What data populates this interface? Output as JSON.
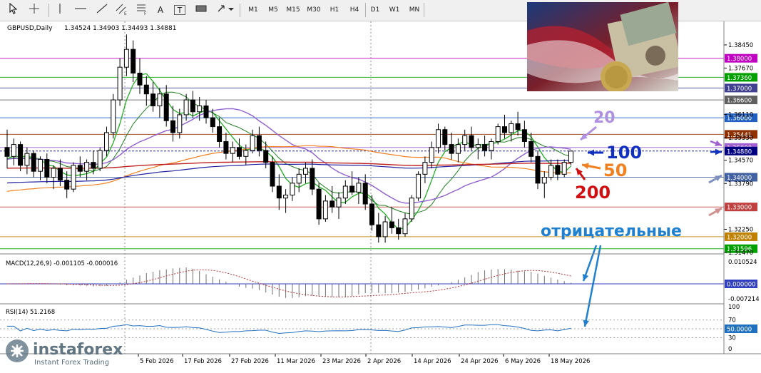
{
  "toolbar": {
    "timeframes": [
      "M1",
      "M5",
      "M15",
      "M30",
      "H1",
      "H4",
      "D1",
      "W1",
      "MN"
    ],
    "tools": {
      "crosshair": "crosshair-icon",
      "vline": "vertical-line-icon",
      "hline": "horizontal-line-icon",
      "trendline": "trendline-icon",
      "equidistant": "equidistant-channel-icon",
      "fibo": "fibonacci-icon",
      "text": "A",
      "label": "T",
      "rect": "rectangle-icon",
      "arrows": "arrows-icon"
    }
  },
  "header": {
    "symbol": "GBPUSD,Daily",
    "ohlc": "1.34524 1.34903 1.34493 1.34881"
  },
  "macd": {
    "label": "MACD(12,26,9) -0.001105 -0.000016",
    "axis": [
      "0.010524",
      "0.000000",
      "-0.007214"
    ]
  },
  "rsi": {
    "label": "RSI(14) 51.2168",
    "axis": [
      "100",
      "70",
      "50.0000",
      "30",
      "0"
    ]
  },
  "price_axis": {
    "ticks": [
      "1.38450",
      "1.37670",
      "1.36110",
      "1.35330",
      "1.34570",
      "1.33790",
      "1.32250",
      "1.31470"
    ],
    "levels": [
      {
        "label": "1.38000",
        "color": "#c000c0"
      },
      {
        "label": "1.37360",
        "color": "#00a000"
      },
      {
        "label": "1.37000",
        "color": "#404090"
      },
      {
        "label": "1.36600",
        "color": "#606060"
      },
      {
        "label": "1.36000",
        "color": "#2060c0"
      },
      {
        "label": "1.35441",
        "color": "#903000"
      },
      {
        "label": "1.35000",
        "color": "#a060d0"
      },
      {
        "label": "1.34880",
        "color": "#000080"
      },
      {
        "label": "1.34000",
        "color": "#4060a0"
      },
      {
        "label": "1.33000",
        "color": "#c04040"
      },
      {
        "label": "1.32000",
        "color": "#c08000"
      },
      {
        "label": "1.31596",
        "color": "#00a000"
      }
    ]
  },
  "annotations": {
    "ma20": "20",
    "ma100": "100",
    "ma50": "50",
    "ma200": "200",
    "negative": "отрицательные"
  },
  "date_axis": [
    "5 Feb 2026",
    "17 Feb 2026",
    "27 Feb 2026",
    "11 Mar 2026",
    "23 Mar 2026",
    "2 Apr 2026",
    "14 Apr 2026",
    "24 Apr 2026",
    "6 May 2026",
    "18 May 2026"
  ],
  "logo": {
    "brand": "instaforex",
    "tagline": "Instant Forex Trading"
  },
  "colors": {
    "up": "#ffffff",
    "down": "#000000",
    "ma20": "#9060d0",
    "ma50": "#f08020",
    "ma100": "#2020a0",
    "ma200": "#c02020",
    "fast_green": "#20b020",
    "ann_blue": "#2080d0"
  },
  "chart_data": {
    "type": "candlestick",
    "title": "GBPUSD,Daily",
    "ylim": [
      1.3147,
      1.3876
    ],
    "candles": [
      [
        1.35,
        1.356,
        1.343,
        1.347
      ],
      [
        1.347,
        1.353,
        1.344,
        1.351
      ],
      [
        1.351,
        1.352,
        1.342,
        1.344
      ],
      [
        1.344,
        1.35,
        1.341,
        1.348
      ],
      [
        1.348,
        1.349,
        1.34,
        1.342
      ],
      [
        1.342,
        1.347,
        1.339,
        1.346
      ],
      [
        1.346,
        1.348,
        1.338,
        1.34
      ],
      [
        1.34,
        1.344,
        1.336,
        1.343
      ],
      [
        1.343,
        1.346,
        1.337,
        1.339
      ],
      [
        1.339,
        1.342,
        1.333,
        1.336
      ],
      [
        1.336,
        1.345,
        1.335,
        1.344
      ],
      [
        1.344,
        1.347,
        1.34,
        1.342
      ],
      [
        1.342,
        1.346,
        1.339,
        1.345
      ],
      [
        1.345,
        1.349,
        1.341,
        1.343
      ],
      [
        1.343,
        1.35,
        1.342,
        1.349
      ],
      [
        1.349,
        1.357,
        1.347,
        1.355
      ],
      [
        1.355,
        1.368,
        1.353,
        1.366
      ],
      [
        1.366,
        1.38,
        1.364,
        1.377
      ],
      [
        1.377,
        1.388,
        1.374,
        1.383
      ],
      [
        1.383,
        1.386,
        1.372,
        1.375
      ],
      [
        1.375,
        1.38,
        1.368,
        1.371
      ],
      [
        1.371,
        1.374,
        1.364,
        1.368
      ],
      [
        1.368,
        1.372,
        1.362,
        1.364
      ],
      [
        1.364,
        1.37,
        1.36,
        1.368
      ],
      [
        1.368,
        1.371,
        1.357,
        1.359
      ],
      [
        1.359,
        1.364,
        1.352,
        1.355
      ],
      [
        1.355,
        1.363,
        1.353,
        1.361
      ],
      [
        1.361,
        1.368,
        1.359,
        1.366
      ],
      [
        1.366,
        1.369,
        1.36,
        1.362
      ],
      [
        1.362,
        1.367,
        1.359,
        1.364
      ],
      [
        1.364,
        1.366,
        1.358,
        1.36
      ],
      [
        1.36,
        1.363,
        1.355,
        1.357
      ],
      [
        1.357,
        1.36,
        1.35,
        1.352
      ],
      [
        1.352,
        1.355,
        1.346,
        1.348
      ],
      [
        1.348,
        1.352,
        1.345,
        1.35
      ],
      [
        1.35,
        1.353,
        1.346,
        1.347
      ],
      [
        1.347,
        1.351,
        1.344,
        1.349
      ],
      [
        1.349,
        1.356,
        1.348,
        1.354
      ],
      [
        1.354,
        1.357,
        1.347,
        1.349
      ],
      [
        1.349,
        1.352,
        1.343,
        1.345
      ],
      [
        1.345,
        1.347,
        1.335,
        1.337
      ],
      [
        1.337,
        1.341,
        1.329,
        1.333
      ],
      [
        1.333,
        1.336,
        1.328,
        1.334
      ],
      [
        1.334,
        1.34,
        1.332,
        1.338
      ],
      [
        1.338,
        1.343,
        1.335,
        1.341
      ],
      [
        1.341,
        1.345,
        1.338,
        1.343
      ],
      [
        1.343,
        1.346,
        1.334,
        1.336
      ],
      [
        1.336,
        1.338,
        1.324,
        1.326
      ],
      [
        1.326,
        1.334,
        1.325,
        1.332
      ],
      [
        1.332,
        1.337,
        1.328,
        1.33
      ],
      [
        1.33,
        1.335,
        1.326,
        1.333
      ],
      [
        1.333,
        1.339,
        1.331,
        1.337
      ],
      [
        1.337,
        1.342,
        1.334,
        1.335
      ],
      [
        1.335,
        1.34,
        1.331,
        1.338
      ],
      [
        1.338,
        1.341,
        1.329,
        1.331
      ],
      [
        1.331,
        1.334,
        1.322,
        1.324
      ],
      [
        1.324,
        1.328,
        1.318,
        1.32
      ],
      [
        1.32,
        1.327,
        1.318,
        1.325
      ],
      [
        1.325,
        1.33,
        1.321,
        1.323
      ],
      [
        1.323,
        1.326,
        1.319,
        1.321
      ],
      [
        1.321,
        1.328,
        1.32,
        1.326
      ],
      [
        1.326,
        1.334,
        1.325,
        1.333
      ],
      [
        1.333,
        1.342,
        1.332,
        1.341
      ],
      [
        1.341,
        1.347,
        1.338,
        1.345
      ],
      [
        1.345,
        1.352,
        1.343,
        1.35
      ],
      [
        1.35,
        1.358,
        1.348,
        1.356
      ],
      [
        1.356,
        1.357,
        1.349,
        1.351
      ],
      [
        1.351,
        1.355,
        1.346,
        1.348
      ],
      [
        1.348,
        1.353,
        1.345,
        1.351
      ],
      [
        1.351,
        1.356,
        1.349,
        1.354
      ],
      [
        1.354,
        1.357,
        1.349,
        1.35
      ],
      [
        1.35,
        1.353,
        1.346,
        1.351
      ],
      [
        1.351,
        1.354,
        1.347,
        1.349
      ],
      [
        1.349,
        1.353,
        1.346,
        1.352
      ],
      [
        1.352,
        1.358,
        1.351,
        1.357
      ],
      [
        1.357,
        1.361,
        1.353,
        1.355
      ],
      [
        1.355,
        1.359,
        1.352,
        1.358
      ],
      [
        1.358,
        1.362,
        1.354,
        1.356
      ],
      [
        1.356,
        1.359,
        1.35,
        1.352
      ],
      [
        1.352,
        1.355,
        1.345,
        1.347
      ],
      [
        1.347,
        1.349,
        1.336,
        1.338
      ],
      [
        1.338,
        1.342,
        1.333,
        1.34
      ],
      [
        1.34,
        1.346,
        1.339,
        1.344
      ],
      [
        1.344,
        1.346,
        1.339,
        1.341
      ],
      [
        1.341,
        1.346,
        1.34,
        1.345
      ],
      [
        1.345,
        1.349,
        1.344,
        1.3488
      ]
    ],
    "series": [
      {
        "name": "20",
        "color": "#9060d0"
      },
      {
        "name": "50",
        "color": "#f08020"
      },
      {
        "name": "100",
        "color": "#2020a0"
      },
      {
        "name": "200",
        "color": "#c02020"
      }
    ],
    "macd_hist_last": -0.001105,
    "macd_signal_last": -1.6e-05,
    "rsi_last": 51.2168
  }
}
